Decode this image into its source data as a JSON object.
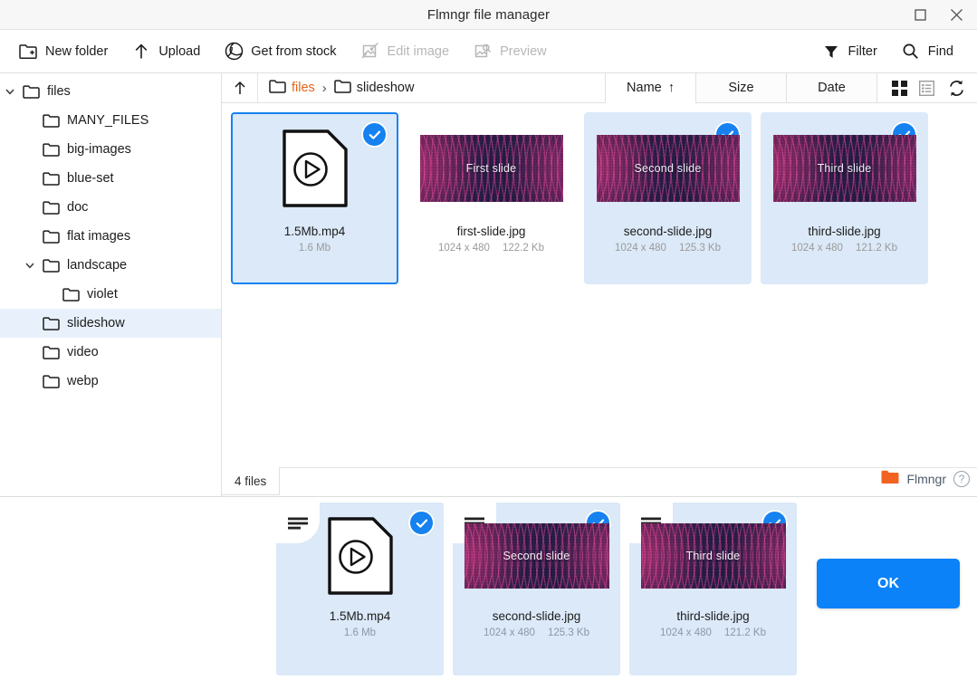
{
  "window": {
    "title": "Flmngr file manager",
    "maximize_icon": "maximize-icon",
    "close_icon": "close-icon"
  },
  "toolbar": {
    "items": [
      {
        "label": "New folder",
        "icon": "new-folder-icon",
        "disabled": false
      },
      {
        "label": "Upload",
        "icon": "upload-arrow-icon",
        "disabled": false
      },
      {
        "label": "Get from stock",
        "icon": "camera-shutter-icon",
        "disabled": false
      },
      {
        "label": "Edit image",
        "icon": "edit-image-icon",
        "disabled": true
      },
      {
        "label": "Preview",
        "icon": "preview-image-icon",
        "disabled": true
      }
    ],
    "right_items": [
      {
        "label": "Filter",
        "icon": "filter-funnel-icon"
      },
      {
        "label": "Find",
        "icon": "search-icon"
      }
    ]
  },
  "sidebar": {
    "items": [
      {
        "label": "files",
        "depth": 0,
        "twisty": "chevron-down",
        "selected": false
      },
      {
        "label": "MANY_FILES",
        "depth": 1,
        "twisty": "none",
        "selected": false
      },
      {
        "label": "big-images",
        "depth": 1,
        "twisty": "none",
        "selected": false
      },
      {
        "label": "blue-set",
        "depth": 1,
        "twisty": "none",
        "selected": false
      },
      {
        "label": "doc",
        "depth": 1,
        "twisty": "none",
        "selected": false
      },
      {
        "label": "flat images",
        "depth": 1,
        "twisty": "none",
        "selected": false
      },
      {
        "label": "landscape",
        "depth": 1,
        "twisty": "chevron-down",
        "selected": false
      },
      {
        "label": "violet",
        "depth": 2,
        "twisty": "none",
        "selected": false
      },
      {
        "label": "slideshow",
        "depth": 1,
        "twisty": "none",
        "selected": true
      },
      {
        "label": "video",
        "depth": 1,
        "twisty": "none",
        "selected": false
      },
      {
        "label": "webp",
        "depth": 1,
        "twisty": "none",
        "selected": false
      }
    ]
  },
  "nav": {
    "up_icon": "up-arrow-icon",
    "breadcrumb": [
      {
        "label": "files",
        "current": false
      },
      {
        "label": "slideshow",
        "current": true
      }
    ],
    "separator": "›"
  },
  "sort": {
    "tabs": [
      {
        "label": "Name",
        "active": true,
        "arrow": "↑"
      },
      {
        "label": "Size",
        "active": false,
        "arrow": ""
      },
      {
        "label": "Date",
        "active": false,
        "arrow": ""
      }
    ],
    "view_modes": [
      {
        "icon": "grid-view-icon",
        "active": true
      },
      {
        "icon": "list-view-icon",
        "active": false
      }
    ],
    "refresh_icon": "refresh-icon"
  },
  "files": [
    {
      "name": "1.5Mb.mp4",
      "kind": "video",
      "size": "1.6 Mb",
      "dimensions": "",
      "selected": true,
      "focused": true,
      "thumb_label": ""
    },
    {
      "name": "first-slide.jpg",
      "kind": "image",
      "size": "122.2 Kb",
      "dimensions": "1024 x 480",
      "selected": false,
      "focused": false,
      "thumb_label": "First slide"
    },
    {
      "name": "second-slide.jpg",
      "kind": "image",
      "size": "125.3 Kb",
      "dimensions": "1024 x 480",
      "selected": true,
      "focused": false,
      "thumb_label": "Second slide"
    },
    {
      "name": "third-slide.jpg",
      "kind": "image",
      "size": "121.2 Kb",
      "dimensions": "1024 x 480",
      "selected": true,
      "focused": false,
      "thumb_label": "Third slide"
    }
  ],
  "status": {
    "file_count_label": "4 files",
    "brand_name": "Flmngr",
    "brand_icon": "orange-folder-icon",
    "help_icon": "help-circle-icon",
    "help_glyph": "?"
  },
  "selection_bar": {
    "tiles": [
      {
        "name": "1.5Mb.mp4",
        "kind": "video",
        "size": "1.6 Mb",
        "dimensions": "",
        "thumb_label": "",
        "handle_icon": "drag-handle-icon",
        "checked": true
      },
      {
        "name": "second-slide.jpg",
        "kind": "image",
        "size": "125.3 Kb",
        "dimensions": "1024 x 480",
        "thumb_label": "Second slide",
        "handle_icon": "drag-handle-icon",
        "checked": true
      },
      {
        "name": "third-slide.jpg",
        "kind": "image",
        "size": "121.2 Kb",
        "dimensions": "1024 x 480",
        "thumb_label": "Third slide",
        "handle_icon": "drag-handle-icon",
        "checked": true
      }
    ],
    "ok_label": "OK"
  },
  "colors": {
    "accent_blue": "#1682f0",
    "ok_button": "#0b82f7",
    "selected_tile": "#dbe9f8",
    "sidebar_selected": "#e8f1fb",
    "breadcrumb_link": "#e2661a",
    "brand_orange": "#f26322",
    "slide_bg": "#241b42",
    "slide_pattern": "#ec4899"
  }
}
